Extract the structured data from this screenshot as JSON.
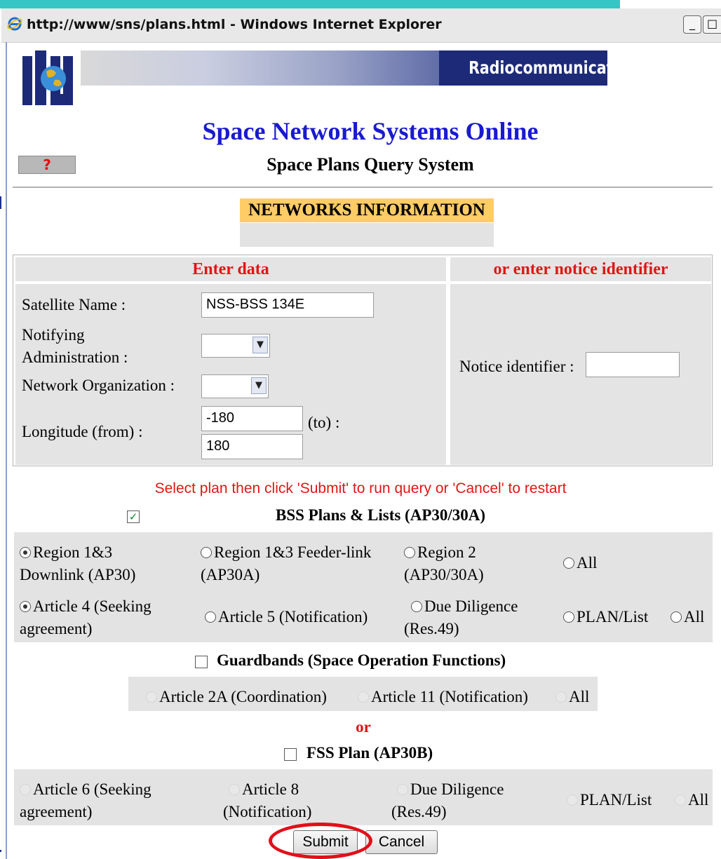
{
  "window": {
    "title": "http://www/sns/plans.html - Windows Internet Explorer",
    "minimize": "_",
    "maximize": "□"
  },
  "header": {
    "banner_text": "Radiocommunication",
    "logo_text": "ITU",
    "title": "Space Network Systems Online",
    "subtitle": "Space Plans Query System",
    "help_label": "?"
  },
  "networks": {
    "label": "NETWORKS INFORMATION"
  },
  "form": {
    "enter_data_header": "Enter data",
    "notice_header": "or enter notice identifier",
    "satellite_name_label": "Satellite Name :",
    "satellite_name_value": "NSS-BSS 134E",
    "notifying_admin_label_1": "Notifying",
    "notifying_admin_label_2": "Administration :",
    "notifying_admin_value": "",
    "network_org_label": "Network Organization :",
    "network_org_value": "",
    "longitude_label": "Longitude (from) :",
    "longitude_from": "-180",
    "longitude_to_label": "(to) :",
    "longitude_to": "180",
    "notice_identifier_label": "Notice identifier :",
    "notice_identifier_value": ""
  },
  "instructions": "Select plan then click 'Submit' to run query or 'Cancel' to restart",
  "bss": {
    "checked": true,
    "title": "BSS Plans & Lists (AP30/30A)",
    "row1": [
      {
        "label_1": "Region 1&3",
        "label_2": "Downlink (AP30)",
        "selected": true
      },
      {
        "label_1": "Region 1&3 Feeder-link",
        "label_2": "(AP30A)",
        "selected": false
      },
      {
        "label_1": "Region 2",
        "label_2": "(AP30/30A)",
        "selected": false
      },
      {
        "label_1": "All",
        "label_2": "",
        "selected": false
      }
    ],
    "row2": [
      {
        "label_1": "Article 4 (Seeking",
        "label_2": "agreement)",
        "selected": true
      },
      {
        "label_1": "Article 5 (Notification)",
        "label_2": "",
        "selected": false
      },
      {
        "label_1": "Due Diligence",
        "label_2": "(Res.49)",
        "selected": false
      },
      {
        "label_1": "PLAN/List",
        "label_2": "",
        "selected": false
      },
      {
        "label_1": "All",
        "label_2": "",
        "selected": false
      }
    ]
  },
  "guardbands": {
    "checked": false,
    "title": "Guardbands (Space Operation Functions)",
    "options": [
      "Article 2A (Coordination)",
      "Article 11 (Notification)",
      "All"
    ]
  },
  "or_label": "or",
  "fss": {
    "checked": false,
    "title": "FSS Plan (AP30B)",
    "options": [
      {
        "label_1": "Article 6 (Seeking",
        "label_2": "agreement)"
      },
      {
        "label_1": "Article 8",
        "label_2": "(Notification)"
      },
      {
        "label_1": "Due Diligence",
        "label_2": "(Res.49)"
      },
      {
        "label_1": "PLAN/List",
        "label_2": ""
      },
      {
        "label_1": "All",
        "label_2": ""
      }
    ]
  },
  "buttons": {
    "submit": "Submit",
    "cancel": "Cancel"
  },
  "colors": {
    "title_blue": "#1a1ad0",
    "header_red": "#e01616",
    "banner_navy": "#1c2a78",
    "highlight_orange": "#ffcc66",
    "annotation_red": "#e0101a"
  }
}
